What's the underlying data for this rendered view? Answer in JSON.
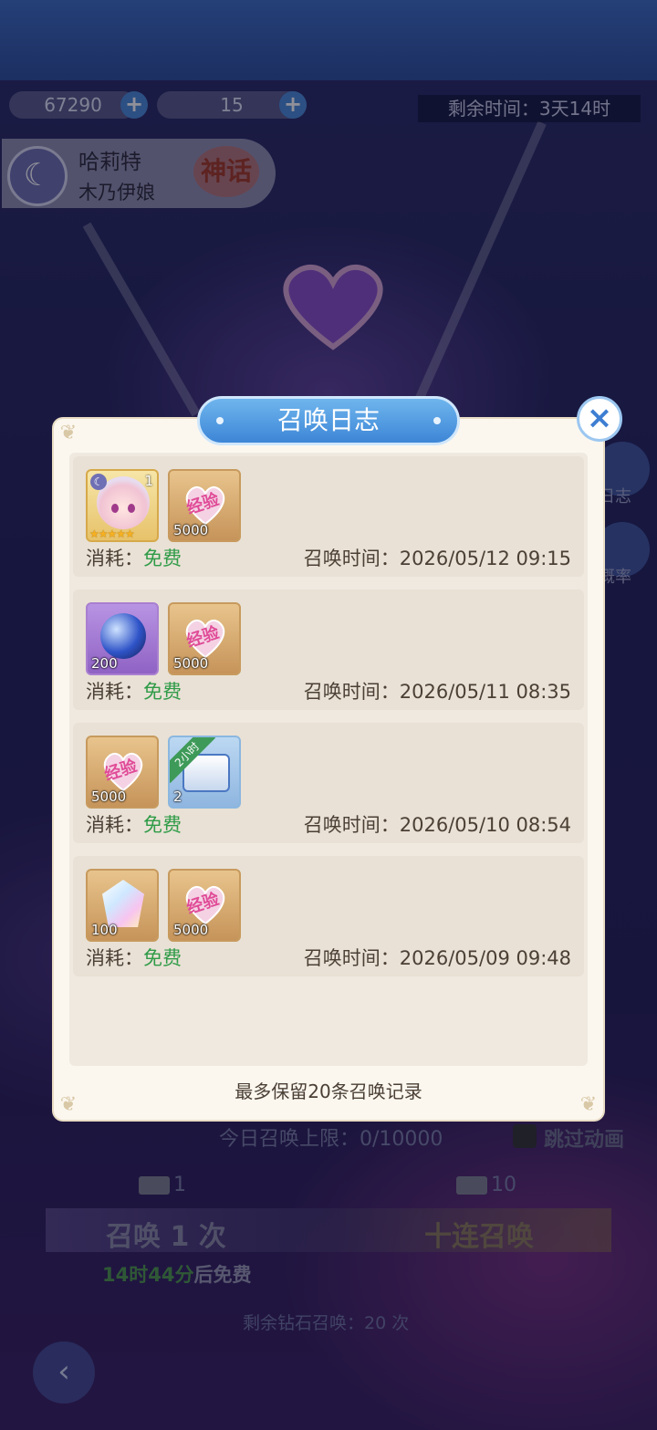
{
  "resources": {
    "diamond": "67290",
    "ticket": "15"
  },
  "timer": {
    "label": "剩余时间：",
    "value": "3天14时"
  },
  "hero": {
    "name": "哈莉特",
    "sub": "木乃伊娘",
    "rarity": "神话"
  },
  "side": {
    "log_label": "日志",
    "rate_label": "概率"
  },
  "modal": {
    "title": "召唤日志",
    "records": [
      {
        "items": [
          {
            "type": "hero-portrait",
            "qty": "1"
          },
          {
            "type": "exp-heart",
            "qty": "5000"
          }
        ],
        "cost_label": "消耗：",
        "cost_value": "免费",
        "time_label": "召唤时间：",
        "time_value": "2026/05/12 09:15"
      },
      {
        "items": [
          {
            "type": "crystal-orb",
            "qty": "200"
          },
          {
            "type": "exp-heart",
            "qty": "5000"
          }
        ],
        "cost_label": "消耗：",
        "cost_value": "免费",
        "time_label": "召唤时间：",
        "time_value": "2026/05/11 08:35"
      },
      {
        "items": [
          {
            "type": "exp-heart",
            "qty": "5000"
          },
          {
            "type": "treasure-chest",
            "qty": "2",
            "ribbon": "2小时"
          }
        ],
        "cost_label": "消耗：",
        "cost_value": "免费",
        "time_label": "召唤时间：",
        "time_value": "2026/05/10 08:54"
      },
      {
        "items": [
          {
            "type": "rainbow-crystal",
            "qty": "100"
          },
          {
            "type": "exp-heart",
            "qty": "5000"
          }
        ],
        "cost_label": "消耗：",
        "cost_value": "免费",
        "time_label": "召唤时间：",
        "time_value": "2026/05/09 09:48"
      }
    ],
    "exp_text": "经验",
    "footer": "最多保留20条召唤记录"
  },
  "lower": {
    "limit": "今日召唤上限：0/10000",
    "skip": "跳过动画",
    "ticket_one": "1",
    "ticket_ten": "10",
    "summon_one": "召唤 1 次",
    "summon_ten": "十连召唤",
    "free_timer": "14时44分",
    "free_suffix": "后免费",
    "remain": "剩余钻石召唤：20 次"
  },
  "colors": {
    "accent": "#3d86d6",
    "free": "#2f9b48",
    "panel": "#fbf7ef"
  }
}
